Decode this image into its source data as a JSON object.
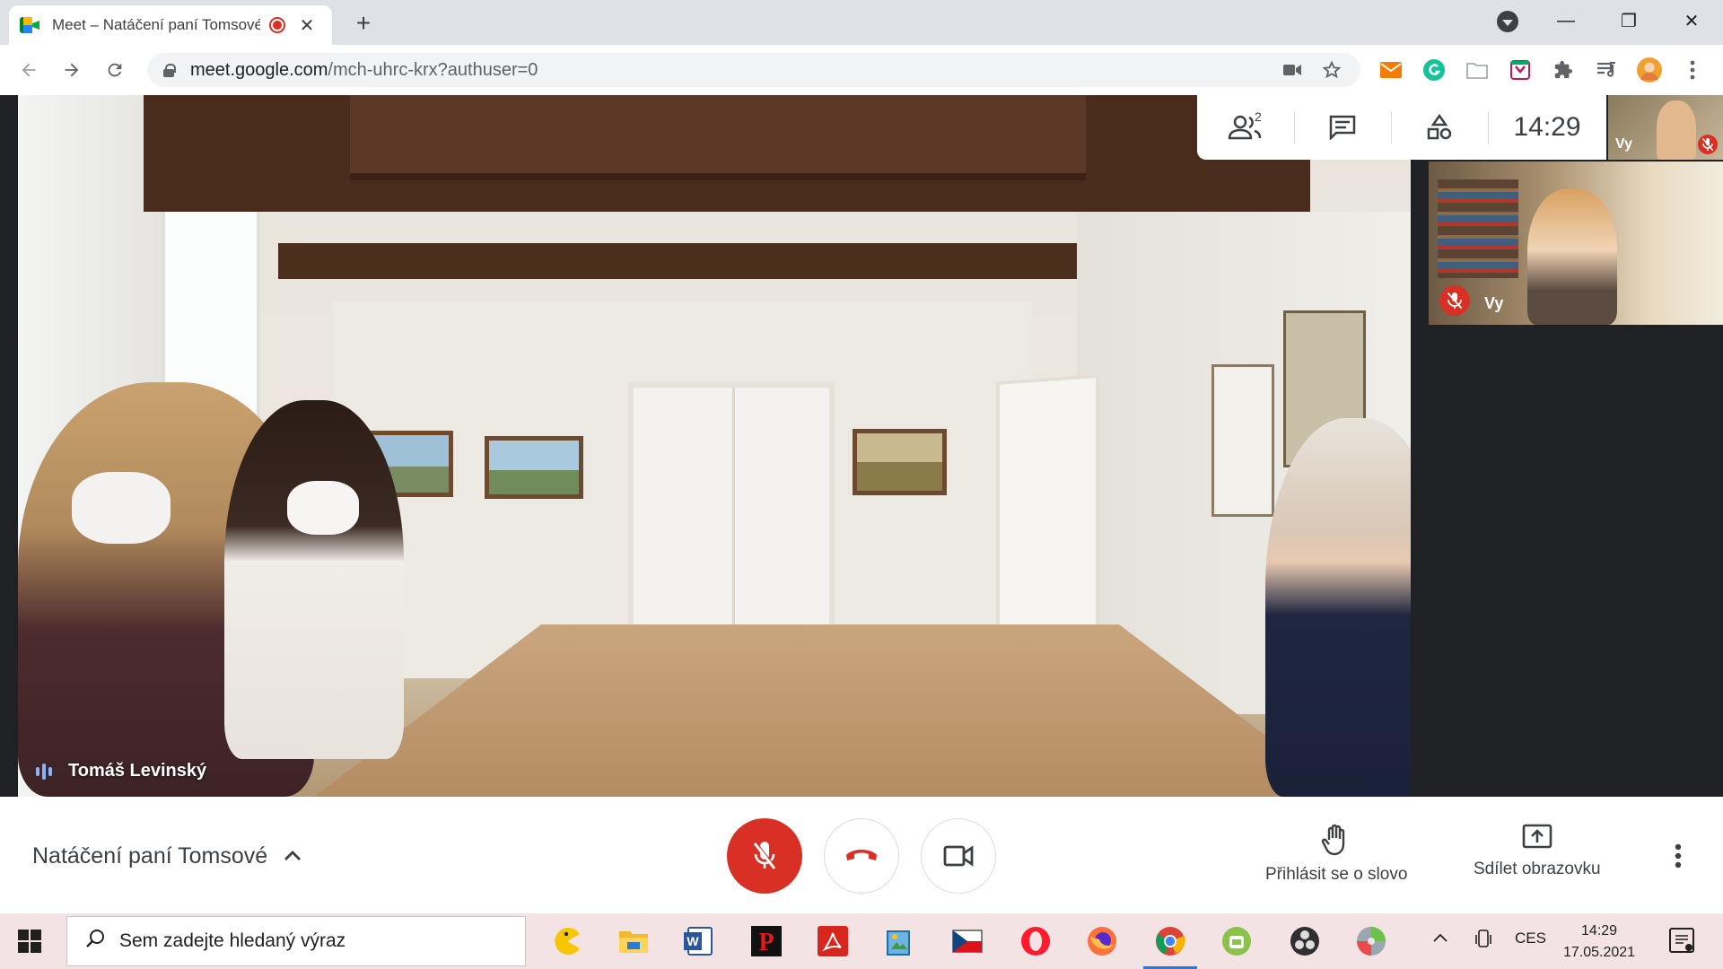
{
  "browser": {
    "tab_title": "Meet – Natáčení paní Tomsové",
    "tab_close": "✕",
    "new_tab": "+",
    "url_host": "meet.google.com",
    "url_path": "/mch-uhrc-krx?authuser=0",
    "window_minimize": "—",
    "window_restore": "❐",
    "window_close": "✕"
  },
  "meet": {
    "speaker_name": "Tomáš Levinský",
    "participants_count": "2",
    "clock": "14:29",
    "self_mini_label": "Vy",
    "tile_label": "Vy",
    "meeting_title": "Natáčení paní Tomsové",
    "raise_hand_label": "Přihlásit se o slovo",
    "present_label": "Sdílet obrazovku",
    "colors": {
      "accent": "#1a73e8",
      "danger": "#d93025",
      "speaking": "#8ab4f8"
    }
  },
  "taskbar": {
    "search_placeholder": "Sem zadejte hledaný výraz",
    "language": "CES",
    "time": "14:29",
    "date": "17.05.2021"
  }
}
